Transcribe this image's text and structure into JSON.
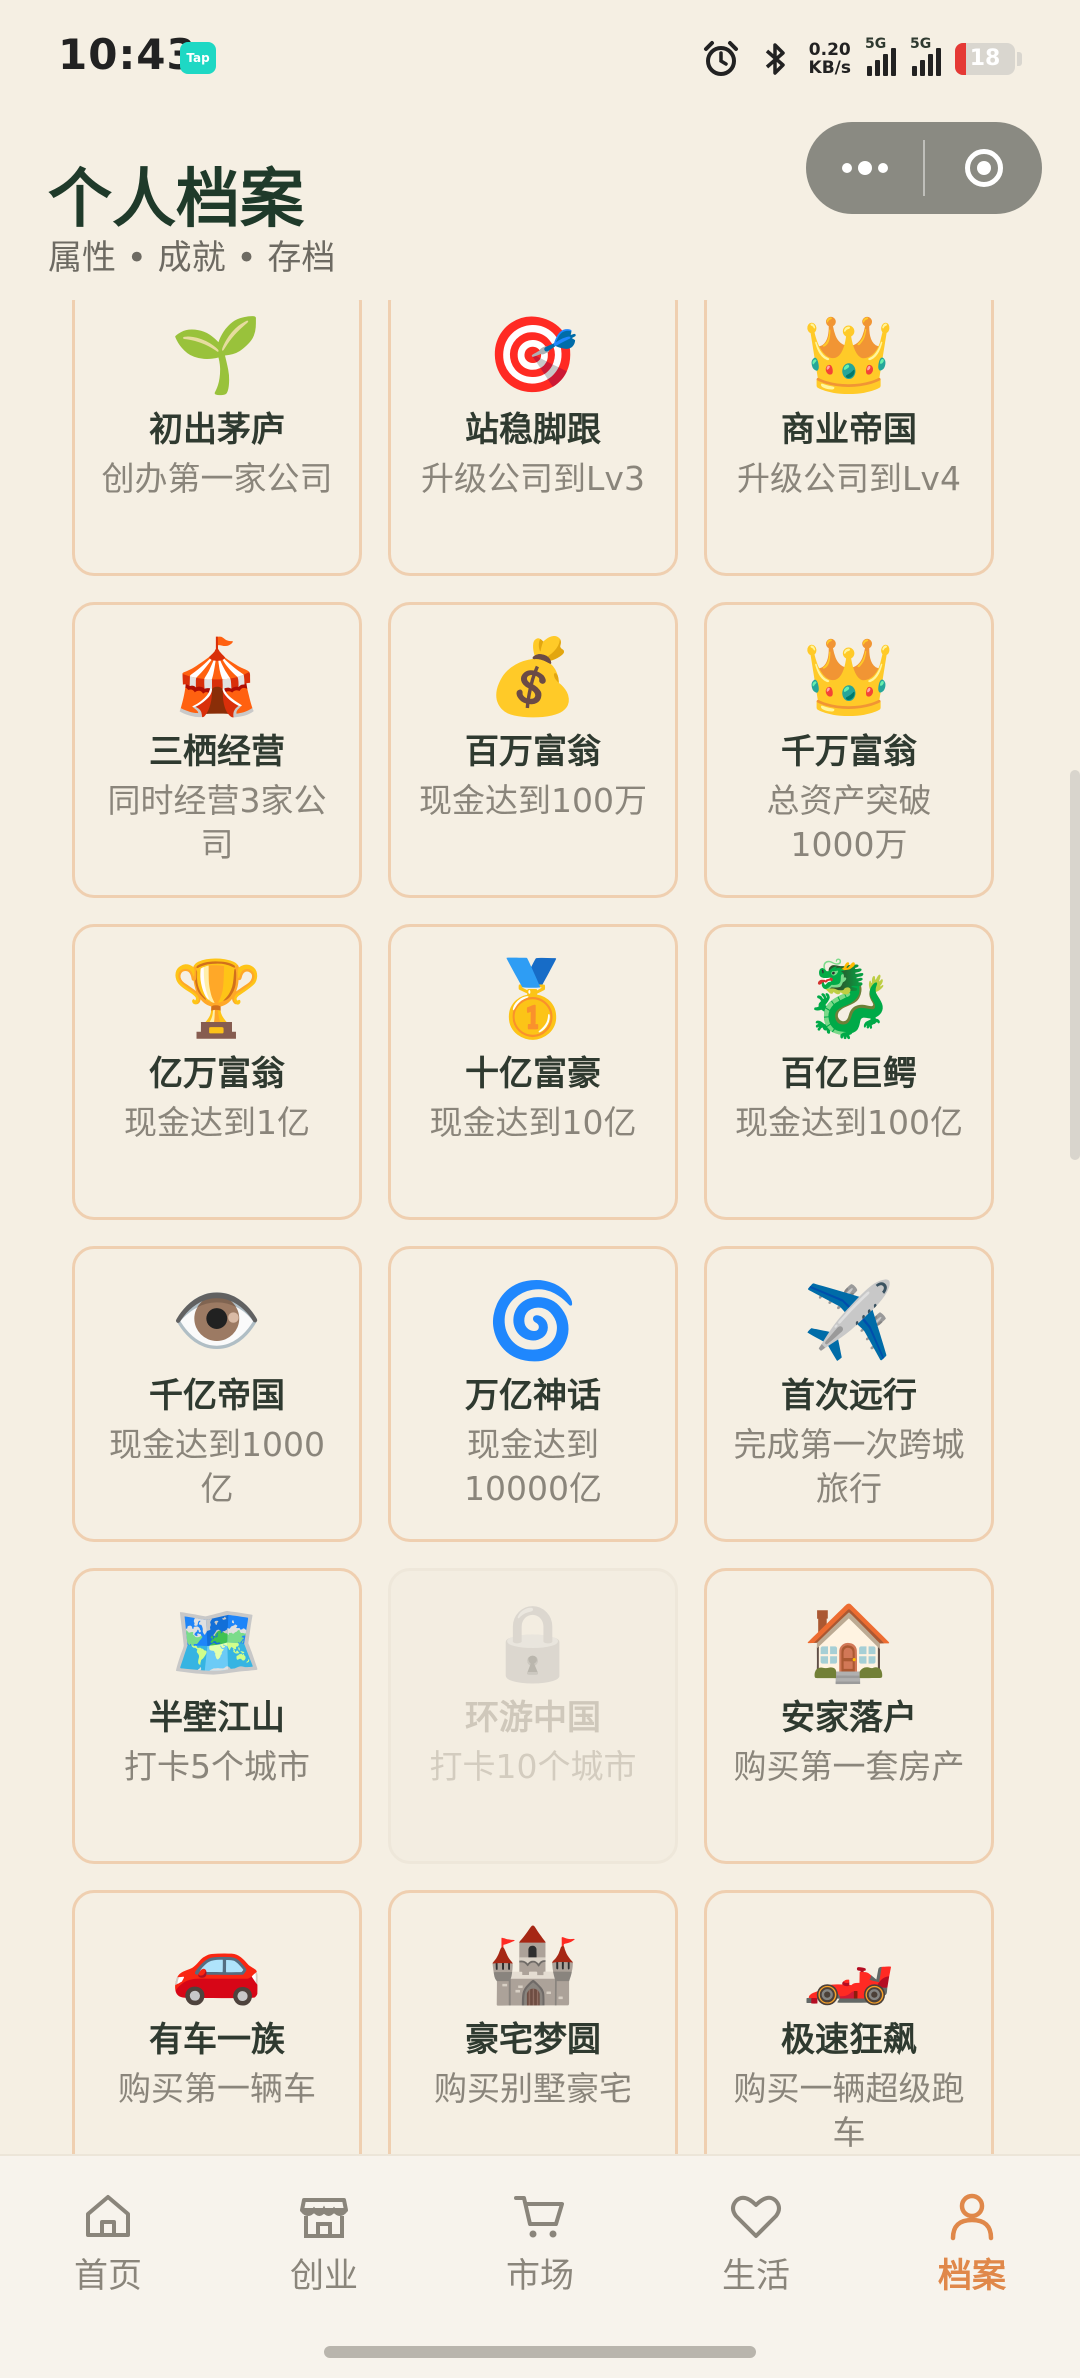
{
  "status_bar": {
    "time": "10:43",
    "tap_badge": "Tap",
    "net_speed_value": "0.20",
    "net_speed_unit": "KB/s",
    "sim1": "5G",
    "sim2": "5G",
    "battery": "18",
    "battery_level": 0.18,
    "battery_color": "#e53935"
  },
  "header": {
    "title": "个人档案",
    "subtitle": "属性 • 成就 • 存档"
  },
  "achievements": [
    {
      "icon": "🌱",
      "name": "初出茅庐",
      "desc": "创办第一家公司",
      "locked": false
    },
    {
      "icon": "🎯",
      "name": "站稳脚跟",
      "desc": "升级公司到Lv3",
      "locked": false
    },
    {
      "icon": "👑",
      "name": "商业帝国",
      "desc": "升级公司到Lv4",
      "locked": false
    },
    {
      "icon": "🎪",
      "name": "三栖经营",
      "desc": "同时经营3家公司",
      "locked": false
    },
    {
      "icon": "💰",
      "name": "百万富翁",
      "desc": "现金达到100万",
      "locked": false
    },
    {
      "icon": "👑",
      "name": "千万富翁",
      "desc": "总资产突破1000万",
      "locked": false
    },
    {
      "icon": "🏆",
      "name": "亿万富翁",
      "desc": "现金达到1亿",
      "locked": false
    },
    {
      "icon": "🥇",
      "name": "十亿富豪",
      "desc": "现金达到10亿",
      "locked": false
    },
    {
      "icon": "🐉",
      "name": "百亿巨鳄",
      "desc": "现金达到100亿",
      "locked": false
    },
    {
      "icon": "👁️",
      "name": "千亿帝国",
      "desc": "现金达到1000亿",
      "locked": false
    },
    {
      "icon": "🌀",
      "name": "万亿神话",
      "desc": "现金达到10000亿",
      "locked": false
    },
    {
      "icon": "✈️",
      "name": "首次远行",
      "desc": "完成第一次跨城旅行",
      "locked": false
    },
    {
      "icon": "🗺️",
      "name": "半壁江山",
      "desc": "打卡5个城市",
      "locked": false
    },
    {
      "icon": "🔒",
      "name": "环游中国",
      "desc": "打卡10个城市",
      "locked": true
    },
    {
      "icon": "🏠",
      "name": "安家落户",
      "desc": "购买第一套房产",
      "locked": false
    },
    {
      "icon": "🚗",
      "name": "有车一族",
      "desc": "购买第一辆车",
      "locked": false
    },
    {
      "icon": "🏰",
      "name": "豪宅梦圆",
      "desc": "购买别墅豪宅",
      "locked": false
    },
    {
      "icon": "🏎️",
      "name": "极速狂飙",
      "desc": "购买一辆超级跑车",
      "locked": false
    }
  ],
  "tabbar": {
    "tabs": [
      {
        "label": "首页",
        "icon": "home-icon"
      },
      {
        "label": "创业",
        "icon": "store-icon"
      },
      {
        "label": "市场",
        "icon": "cart-icon"
      },
      {
        "label": "生活",
        "icon": "heart-icon"
      },
      {
        "label": "档案",
        "icon": "profile-icon"
      }
    ],
    "active_index": 4,
    "active_color": "#e0884a"
  }
}
